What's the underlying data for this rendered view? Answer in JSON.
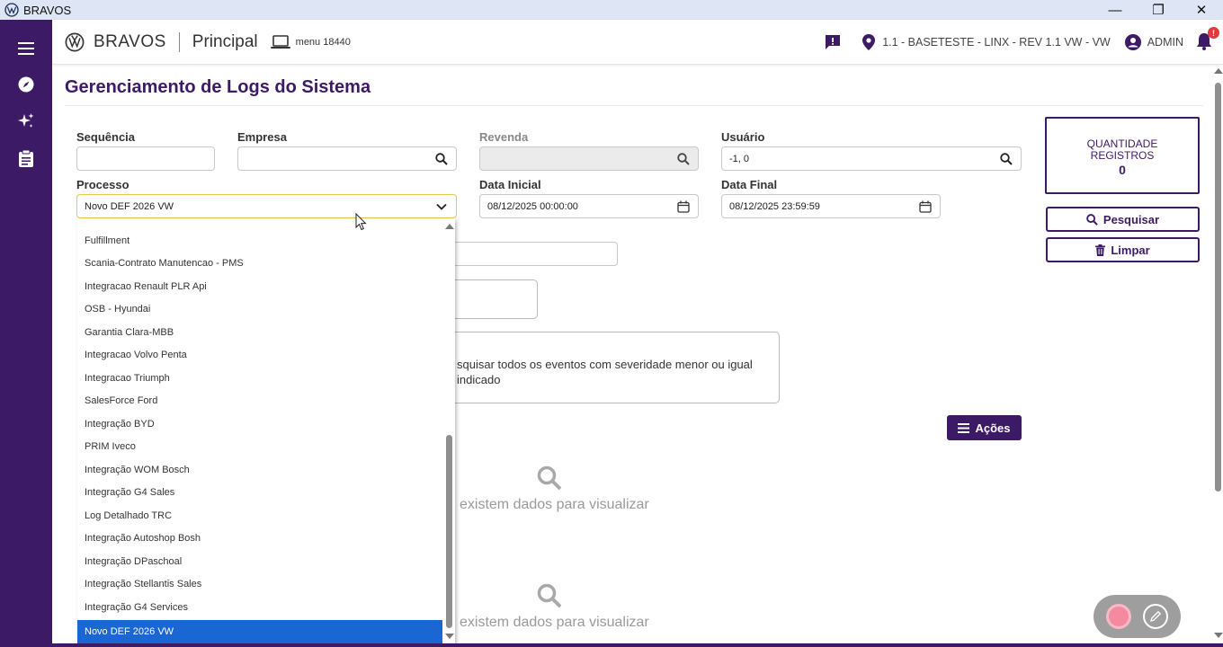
{
  "window": {
    "title": "BRAVOS",
    "minimize": "—",
    "restore": "❐",
    "close": "✕"
  },
  "header": {
    "brand": "BRAVOS",
    "module": "Principal",
    "menu_id": "menu 18440",
    "branch": "1.1 - BASETESTE - LINX - REV 1.1 VW - VW",
    "user": "ADMIN",
    "notification_badge": "!"
  },
  "page": {
    "title": "Gerenciamento de Logs do Sistema"
  },
  "filters": {
    "sequencia_label": "Sequência",
    "sequencia_value": "",
    "empresa_label": "Empresa",
    "empresa_value": "",
    "revenda_label": "Revenda",
    "revenda_value": "",
    "usuario_label": "Usuário",
    "usuario_value": "-1, 0",
    "processo_label": "Processo",
    "processo_value": "Novo DEF 2026 VW",
    "data_inicial_label": "Data Inicial",
    "data_inicial_value": "08/12/2025 00:00:00",
    "data_final_label": "Data Final",
    "data_final_value": "08/12/2025 23:59:59"
  },
  "quantity": {
    "label_line1": "QUANTIDADE",
    "label_line2": "REGISTROS",
    "value": "0"
  },
  "buttons": {
    "pesquisar": "Pesquisar",
    "limpar": "Limpar",
    "acoes": "Ações"
  },
  "info": {
    "line1": "squisar todos os eventos com severidade menor ou igual",
    "line2": "indicado"
  },
  "empty_states": [
    {
      "text": "existem dados para visualizar"
    },
    {
      "text": "existem dados para visualizar"
    }
  ],
  "dropdown": {
    "items": [
      "Fulfillment",
      "Scania-Contrato Manutencao - PMS",
      "Integracao Renault PLR Api",
      "OSB - Hyundai",
      "Garantia Clara-MBB",
      "Integracao Volvo Penta",
      "Integracao Triumph",
      "SalesForce Ford",
      "Integração BYD",
      "PRIM Iveco",
      "Integração WOM Bosch",
      "Integração G4 Sales",
      "Log Detalhado TRC",
      "Integração Autoshop Bosh",
      "Integração DPaschoal",
      "Integração Stellantis Sales",
      "Integração G4 Services",
      "Novo DEF 2026 VW"
    ],
    "selected": "Novo DEF 2026 VW"
  },
  "colors": {
    "brand_purple": "#3d1a66",
    "selected_blue": "#1a66d2"
  }
}
